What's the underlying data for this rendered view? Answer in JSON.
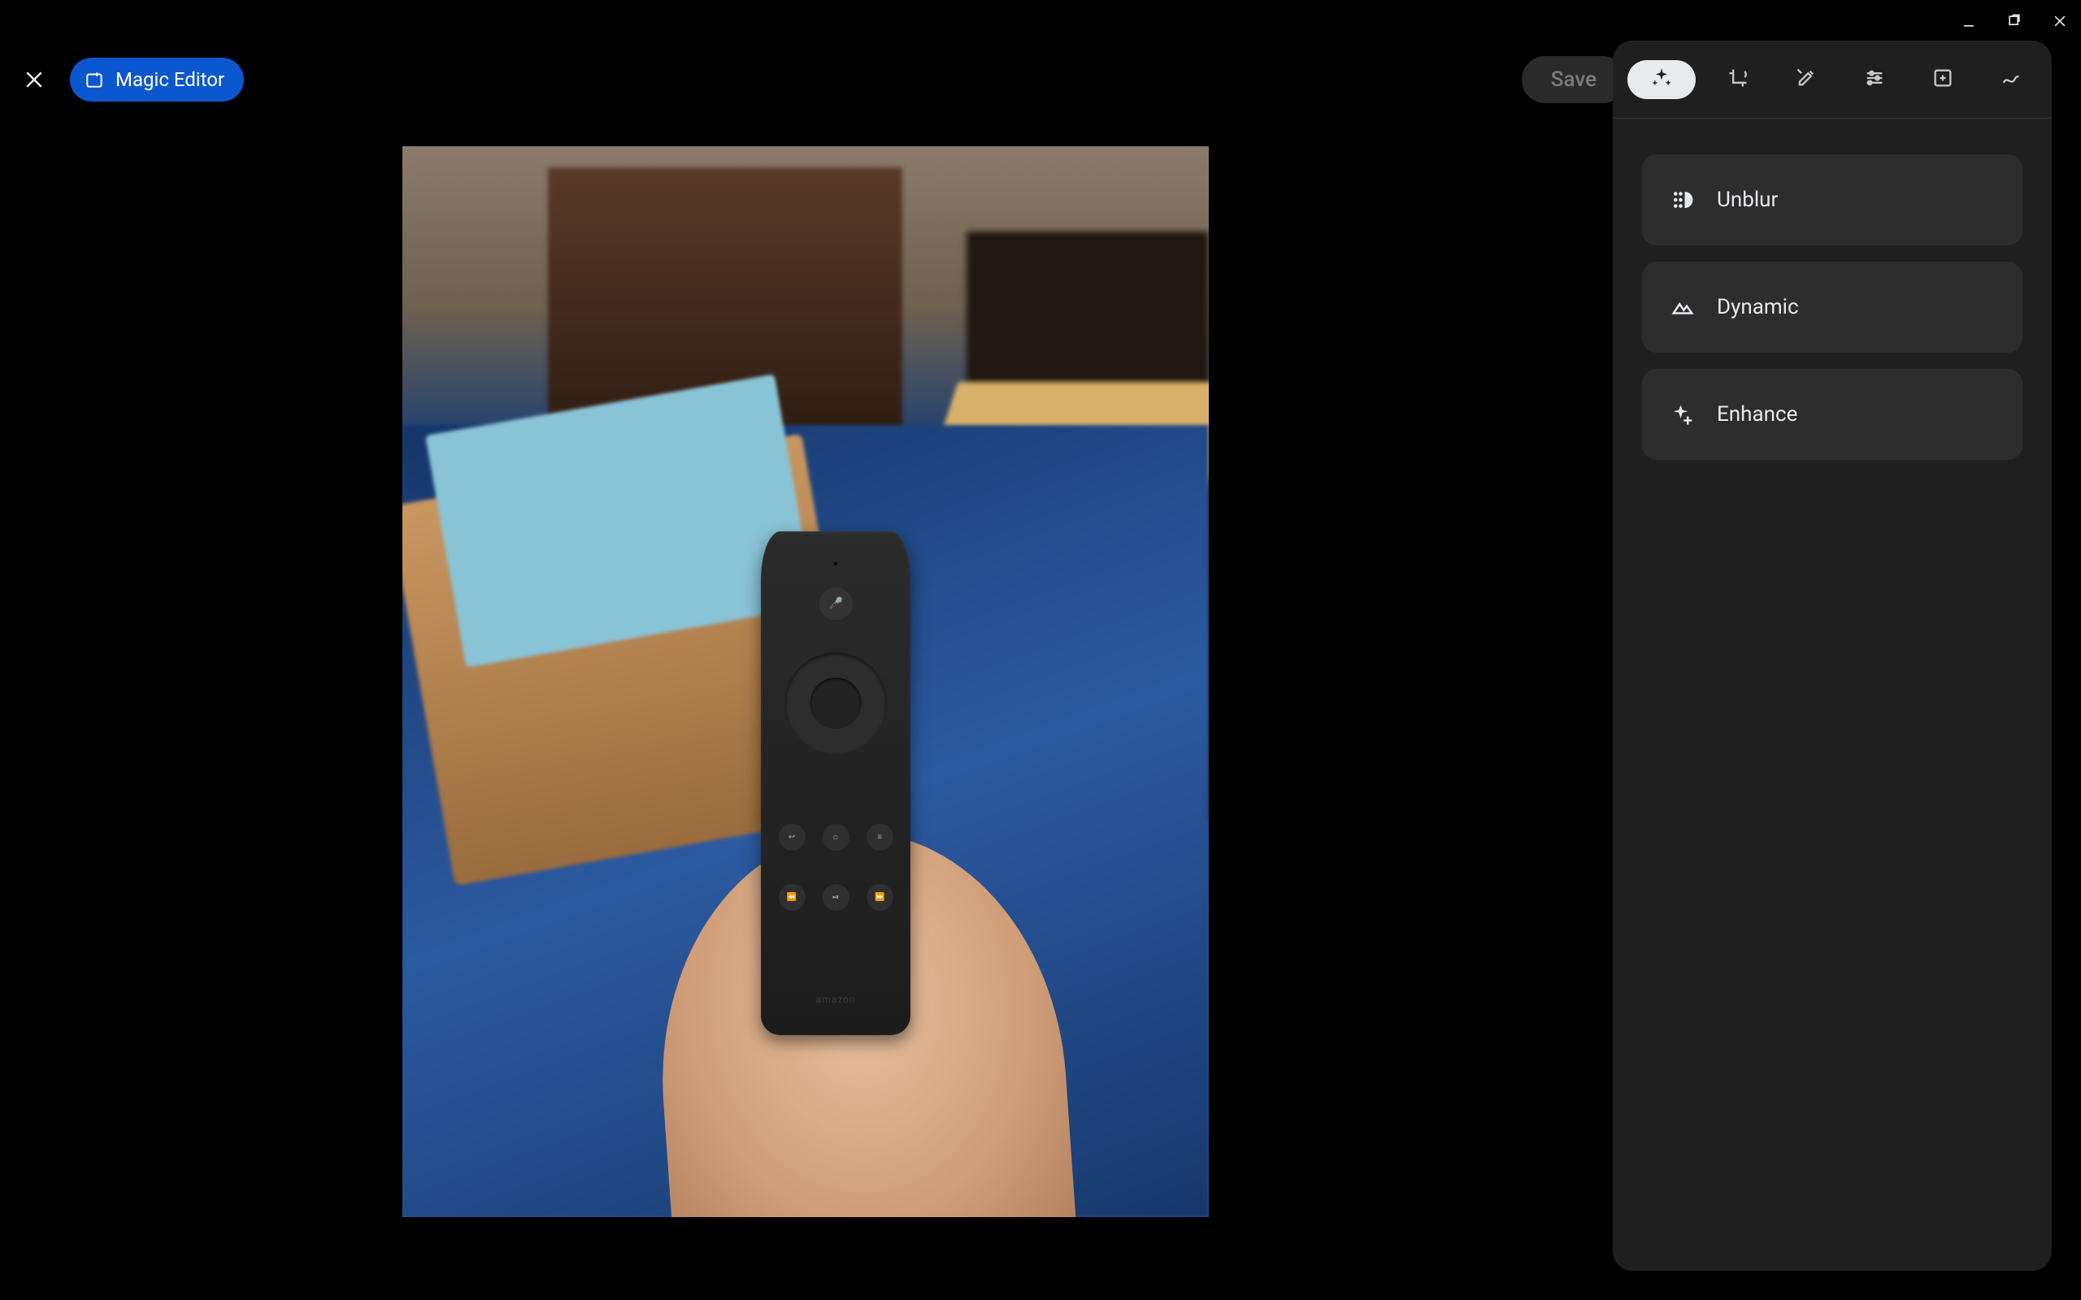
{
  "topbar": {
    "magic_editor_label": "Magic Editor",
    "save_label": "Save"
  },
  "tool_tabs": [
    {
      "name": "suggestions",
      "icon": "sparkle-icon",
      "active": true
    },
    {
      "name": "crop",
      "icon": "crop-rotate-icon",
      "active": false
    },
    {
      "name": "tools",
      "icon": "tools-icon",
      "active": false
    },
    {
      "name": "adjust",
      "icon": "sliders-icon",
      "active": false
    },
    {
      "name": "filters",
      "icon": "filter-add-icon",
      "active": false
    },
    {
      "name": "markup",
      "icon": "markup-icon",
      "active": false
    }
  ],
  "suggestions": [
    {
      "label": "Unblur",
      "icon": "unblur-icon"
    },
    {
      "label": "Dynamic",
      "icon": "landscape-icon"
    },
    {
      "label": "Enhance",
      "icon": "sparkle-plus-icon"
    }
  ],
  "photo": {
    "subject": "hand holding Amazon Fire TV remote over blue rug",
    "brand_text": "amazon"
  }
}
